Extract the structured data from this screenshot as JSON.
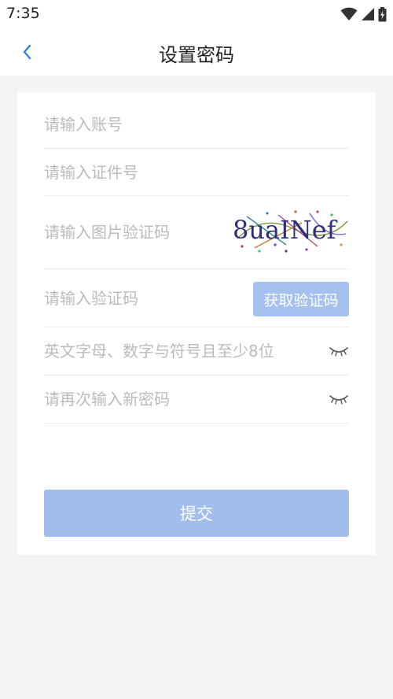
{
  "status_bar": {
    "time": "7:35",
    "icons": [
      "wifi-icon",
      "signal-icon",
      "battery-icon"
    ]
  },
  "header": {
    "title": "设置密码",
    "back_icon": "chevron-left-icon"
  },
  "form": {
    "account_placeholder": "请输入账号",
    "id_placeholder": "请输入证件号",
    "captcha_placeholder": "请输入图片验证码",
    "captcha_text": "8uaINef",
    "sms_placeholder": "请输入验证码",
    "get_code_label": "获取验证码",
    "password_placeholder": "英文字母、数字与符号且至少8位",
    "confirm_placeholder": "请再次输入新密码",
    "eye_icon": "eye-closed-icon"
  },
  "submit": {
    "label": "提交"
  },
  "colors": {
    "accent": "#2a82e4",
    "button_disabled": "#a0bdec",
    "placeholder": "#bbbbbb",
    "background": "#f4f4f4"
  }
}
